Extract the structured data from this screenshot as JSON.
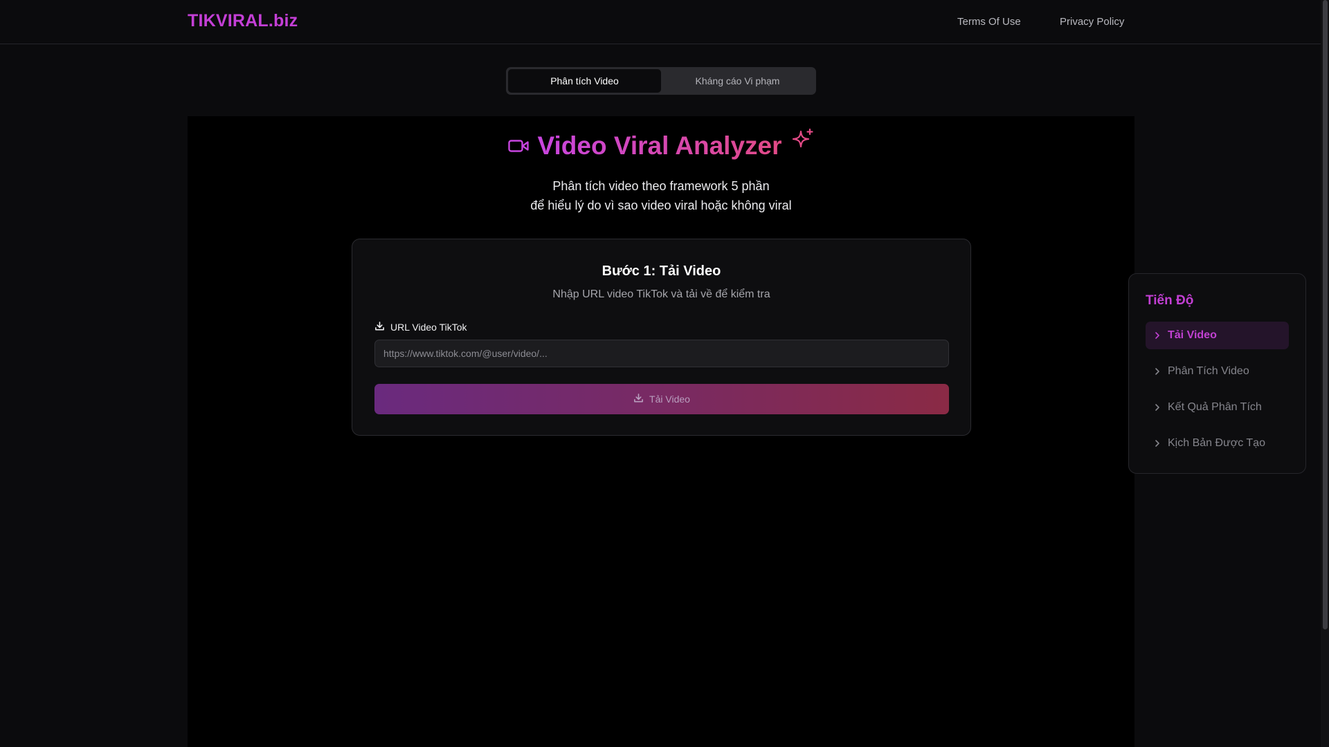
{
  "header": {
    "brand": "TIKVIRAL.biz",
    "nav": {
      "terms": "Terms Of Use",
      "privacy": "Privacy Policy"
    }
  },
  "mode_tabs": {
    "analyze": "Phân tích Video",
    "violation": "Kháng cáo Vi phạm",
    "active": "analyze"
  },
  "hero": {
    "title": "Video Viral Analyzer",
    "subtitle_line1": "Phân tích video theo framework 5 phần",
    "subtitle_line2": "để hiểu lý do vì sao video viral hoặc không viral"
  },
  "step_card": {
    "title": "Bước 1: Tải Video",
    "description": "Nhập URL video TikTok và tải về để kiểm tra",
    "field_label": "URL Video TikTok",
    "input_value": "",
    "input_placeholder": "https://www.tiktok.com/@user/video/...",
    "button_label": "Tải Video"
  },
  "progress": {
    "title": "Tiến Độ",
    "steps": [
      {
        "label": "Tải Video",
        "active": true
      },
      {
        "label": "Phân Tích Video",
        "active": false
      },
      {
        "label": "Kết Quả Phân Tích",
        "active": false
      },
      {
        "label": "Kịch Bản Được Tạo",
        "active": false
      }
    ]
  },
  "icons": {
    "hero_left": "video-camera-icon",
    "hero_right": "sparkles-icon",
    "field": "download-icon",
    "button": "download-icon",
    "step": "chevron-right-icon"
  },
  "colors": {
    "brand": "#c43fd6",
    "gradient_start": "#c845e0",
    "gradient_end": "#e24a86",
    "background": "#0b0b0d"
  }
}
